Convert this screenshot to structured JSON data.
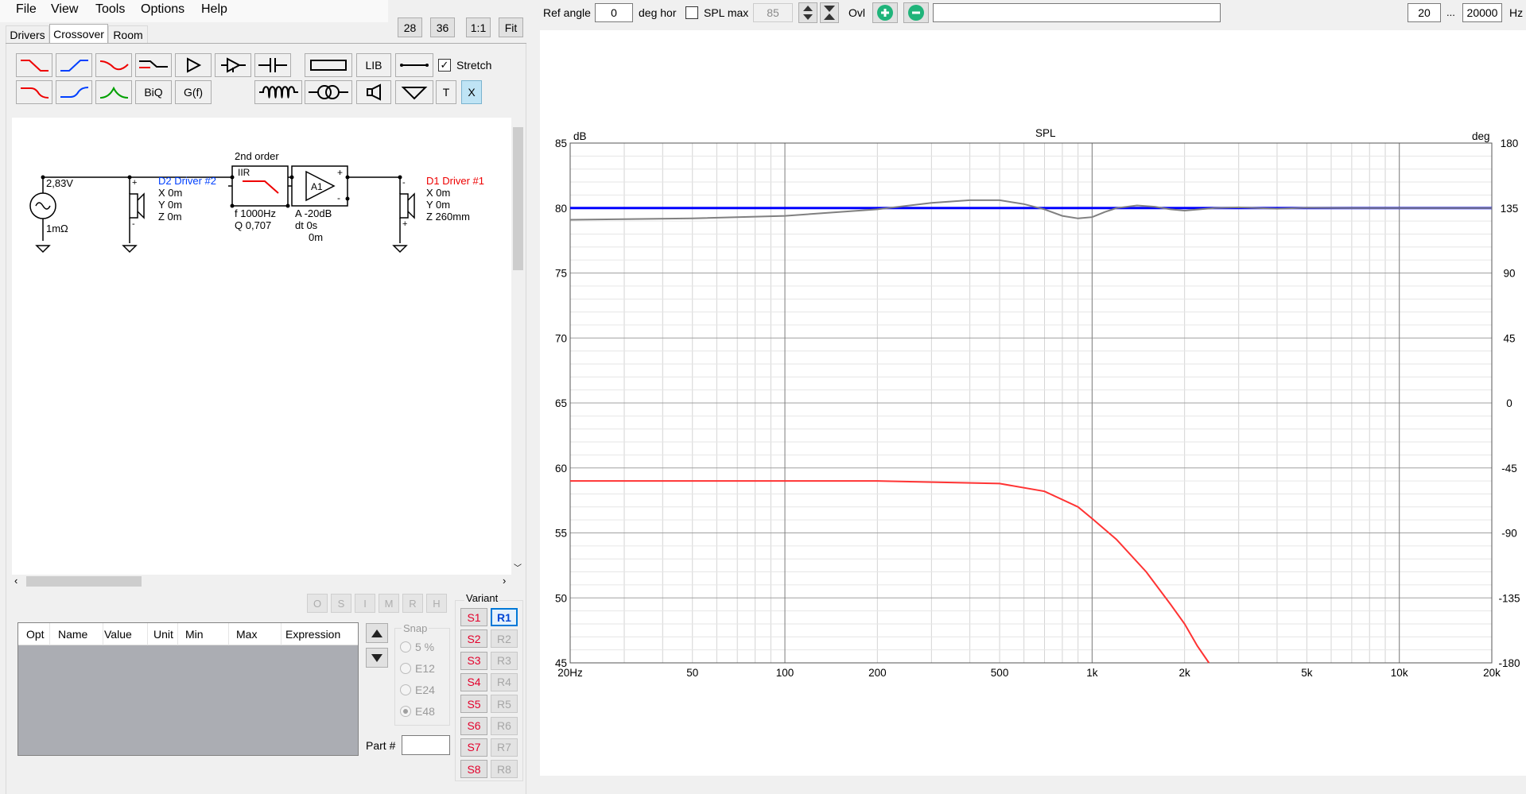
{
  "menu": [
    "File",
    "View",
    "Tools",
    "Options",
    "Help"
  ],
  "zoom_buttons": [
    "28",
    "36",
    "1:1",
    "Fit"
  ],
  "tabs": [
    "Drivers",
    "Crossover",
    "Room"
  ],
  "toolbar": {
    "lib_label": "LIB",
    "biq_label": "BiQ",
    "gf_label": "G(f)",
    "t_label": "T",
    "x_label": "X",
    "stretch_label": "Stretch",
    "stretch_checked": "✓"
  },
  "schematic": {
    "source_voltage": "2,83V",
    "source_impedance": "1mΩ",
    "d2_label": "D2 Driver #2",
    "d2_x": "X 0m",
    "d2_y": "Y 0m",
    "d2_z": "Z 0m",
    "filter_title": "2nd order",
    "filter_type": "IIR",
    "filter_f": "f   1000Hz",
    "filter_q": "Q  0,707",
    "amp_name": "A1",
    "amp_a": "A  -20dB",
    "amp_dt": "dt 0s",
    "amp_m": "0m",
    "d1_label": "D1 Driver #1",
    "d1_x": "X 0m",
    "d1_y": "Y 0m",
    "d1_z": "Z 260mm"
  },
  "opt_buttons": [
    "O",
    "S",
    "I",
    "M",
    "R",
    "H"
  ],
  "opt_table_columns": [
    "Opt",
    "Name",
    "Value",
    "Unit",
    "Min",
    "Max",
    "Expression"
  ],
  "snap": {
    "title": "Snap",
    "options": [
      "5 %",
      "E12",
      "E24",
      "E48"
    ],
    "selected": "E48"
  },
  "part_label": "Part #",
  "variant": {
    "title": "Variant",
    "s": [
      "S1",
      "S2",
      "S3",
      "S4",
      "S5",
      "S6",
      "S7",
      "S8"
    ],
    "r": [
      "R1",
      "R2",
      "R3",
      "R4",
      "R5",
      "R6",
      "R7",
      "R8"
    ],
    "active_r": "R1"
  },
  "graph_toolbar": {
    "ref_angle_label": "Ref angle",
    "ref_angle_value": "0",
    "deg_hor_label": "deg hor",
    "spl_max_label": "SPL max",
    "spl_max_value": "85",
    "ovl_label": "Ovl",
    "freq_min": "20",
    "freq_sep": "...",
    "freq_max": "20000",
    "hz_label": "Hz"
  },
  "chart_data": {
    "type": "line",
    "title": "SPL",
    "ylabel_left": "dB",
    "ylabel_right": "deg",
    "xscale": "log",
    "xlim": [
      20,
      20000
    ],
    "ylim_left": [
      45,
      85
    ],
    "ylim_right": [
      -180,
      180
    ],
    "x_ticks": [
      {
        "v": 20,
        "t": "20Hz"
      },
      {
        "v": 50,
        "t": "50"
      },
      {
        "v": 100,
        "t": "100"
      },
      {
        "v": 200,
        "t": "200"
      },
      {
        "v": 500,
        "t": "500"
      },
      {
        "v": 1000,
        "t": "1k"
      },
      {
        "v": 2000,
        "t": "2k"
      },
      {
        "v": 5000,
        "t": "5k"
      },
      {
        "v": 10000,
        "t": "10k"
      },
      {
        "v": 20000,
        "t": "20k"
      }
    ],
    "y_ticks_left": [
      85,
      80,
      75,
      70,
      65,
      60,
      55,
      50,
      45
    ],
    "y_ticks_right": [
      180,
      135,
      90,
      45,
      0,
      -45,
      -90,
      -135,
      -180
    ],
    "grid": true,
    "series": [
      {
        "color": "#0000ff",
        "axis": "left",
        "x": [
          20,
          20000
        ],
        "y": [
          80,
          80
        ]
      },
      {
        "color": "#ff3333",
        "axis": "left",
        "x": [
          20,
          100,
          200,
          500,
          700,
          900,
          1000,
          1200,
          1500,
          1800,
          2000,
          2200,
          2400
        ],
        "y": [
          59,
          59,
          59,
          58.8,
          58.2,
          57,
          56.1,
          54.5,
          52,
          49.5,
          48,
          46.3,
          45
        ]
      },
      {
        "color": "#808080",
        "axis": "left",
        "x": [
          20,
          50,
          100,
          200,
          300,
          400,
          500,
          600,
          700,
          800,
          900,
          1000,
          1100,
          1200,
          1400,
          1600,
          1800,
          2000,
          2500,
          3000,
          4000,
          5000,
          7000,
          10000,
          20000
        ],
        "y": [
          79.1,
          79.2,
          79.4,
          79.9,
          80.4,
          80.6,
          80.6,
          80.3,
          79.9,
          79.4,
          79.2,
          79.3,
          79.7,
          80.0,
          80.2,
          80.1,
          79.9,
          79.8,
          80.0,
          80.05,
          79.95,
          80.02,
          80.0,
          80.0,
          80.0
        ]
      }
    ]
  }
}
